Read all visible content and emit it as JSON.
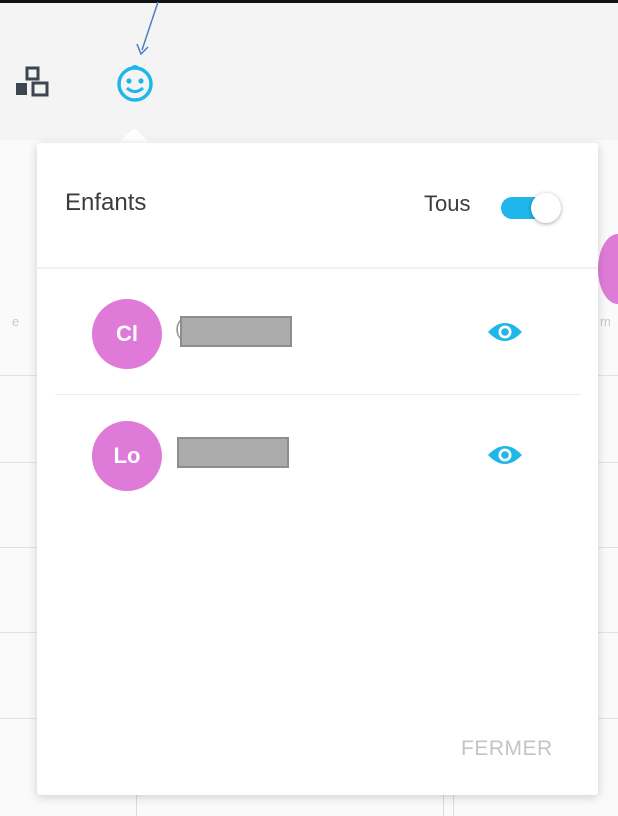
{
  "toolbar": {
    "icons": [
      "blocks-icon",
      "baby-face-icon"
    ],
    "active_icon_color": "#1fb7e9"
  },
  "popover": {
    "title": "Enfants",
    "toggle": {
      "label": "Tous",
      "on": true,
      "color": "#1fb7e9"
    },
    "children": [
      {
        "initials": "Cl",
        "name_fragment": "(",
        "name_redacted": true,
        "visibility_icon": "eye-icon",
        "avatar_color": "#e07ad9"
      },
      {
        "initials": "Lo",
        "name_redacted": true,
        "visibility_icon": "eye-icon",
        "avatar_color": "#e07ad9"
      }
    ],
    "close_button": "FERMER"
  },
  "background": {
    "left_fragment": "e",
    "right_fragment": "m"
  }
}
